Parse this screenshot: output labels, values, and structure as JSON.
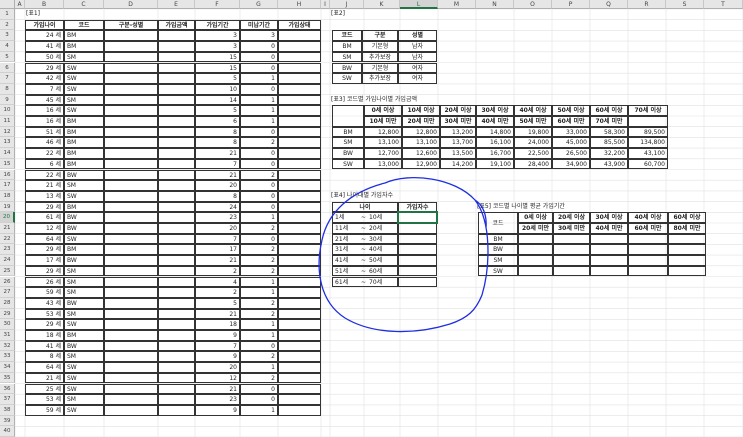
{
  "columns": [
    "A",
    "B",
    "C",
    "D",
    "E",
    "F",
    "G",
    "H",
    "I",
    "J",
    "K",
    "L",
    "M",
    "N",
    "O",
    "P",
    "Q",
    "R",
    "S",
    "T"
  ],
  "rows": [
    "1",
    "2",
    "3",
    "4",
    "5",
    "6",
    "7",
    "8",
    "9",
    "10",
    "11",
    "12",
    "13",
    "14",
    "15",
    "16",
    "17",
    "18",
    "19",
    "20",
    "21",
    "22",
    "23",
    "24",
    "25",
    "26",
    "27",
    "28",
    "29",
    "30",
    "31",
    "32",
    "33",
    "34",
    "35",
    "36",
    "37",
    "38",
    "39",
    "40"
  ],
  "selected_cell": {
    "col": "L",
    "row": "20"
  },
  "t1": {
    "title": "[표1]",
    "headers": [
      "가입나이",
      "코드",
      "구분-성별",
      "가입금액",
      "가입기간",
      "미납기간",
      "가입상태"
    ],
    "rows": [
      [
        "24 세",
        "BM",
        "3",
        "3"
      ],
      [
        "41 세",
        "BM",
        "3",
        "0"
      ],
      [
        "50 세",
        "SM",
        "15",
        "0"
      ],
      [
        "29 세",
        "SW",
        "15",
        "0"
      ],
      [
        "42 세",
        "SW",
        "5",
        "1"
      ],
      [
        "7 세",
        "SW",
        "10",
        "0"
      ],
      [
        "45 세",
        "SM",
        "14",
        "1"
      ],
      [
        "16 세",
        "SW",
        "5",
        "1"
      ],
      [
        "16 세",
        "BM",
        "6",
        "1"
      ],
      [
        "51 세",
        "BM",
        "8",
        "0"
      ],
      [
        "46 세",
        "BM",
        "8",
        "2"
      ],
      [
        "22 세",
        "BM",
        "21",
        "0"
      ],
      [
        "6 세",
        "BM",
        "7",
        "0"
      ],
      [
        "22 세",
        "BW",
        "21",
        "2"
      ],
      [
        "21 세",
        "SM",
        "20",
        "0"
      ],
      [
        "13 세",
        "SW",
        "8",
        "0"
      ],
      [
        "29 세",
        "BM",
        "24",
        "0"
      ],
      [
        "61 세",
        "BW",
        "23",
        "1"
      ],
      [
        "12 세",
        "BW",
        "20",
        "2"
      ],
      [
        "64 세",
        "SW",
        "7",
        "0"
      ],
      [
        "29 세",
        "BM",
        "17",
        "2"
      ],
      [
        "17 세",
        "BW",
        "21",
        "2"
      ],
      [
        "29 세",
        "SM",
        "2",
        "2"
      ],
      [
        "26 세",
        "SM",
        "4",
        "1"
      ],
      [
        "59 세",
        "SM",
        "2",
        "1"
      ],
      [
        "43 세",
        "BW",
        "5",
        "2"
      ],
      [
        "53 세",
        "SM",
        "21",
        "2"
      ],
      [
        "29 세",
        "SW",
        "18",
        "1"
      ],
      [
        "18 세",
        "BM",
        "9",
        "1"
      ],
      [
        "41 세",
        "BW",
        "7",
        "0"
      ],
      [
        "8 세",
        "SM",
        "9",
        "2"
      ],
      [
        "64 세",
        "SW",
        "20",
        "1"
      ],
      [
        "21 세",
        "SW",
        "12",
        "2"
      ],
      [
        "25 세",
        "SW",
        "21",
        "0"
      ],
      [
        "53 세",
        "SM",
        "23",
        "0"
      ],
      [
        "59 세",
        "SW",
        "9",
        "1"
      ]
    ]
  },
  "t2": {
    "title": "[표2]",
    "headers": [
      "코드",
      "구분",
      "성별"
    ],
    "rows": [
      [
        "BM",
        "기본형",
        "남자"
      ],
      [
        "SM",
        "추가보장",
        "남자"
      ],
      [
        "BW",
        "기본형",
        "여자"
      ],
      [
        "SW",
        "추가보장",
        "여자"
      ]
    ]
  },
  "t3": {
    "title": "[표3] 코드별 가입나이별 가입금액",
    "head1": [
      "0세 이상",
      "10세 이상",
      "20세 이상",
      "30세 이상",
      "40세 이상",
      "50세 이상",
      "60세 이상",
      "70세 이상"
    ],
    "head2": [
      "10세 미만",
      "20세 미만",
      "30세 미만",
      "40세 미만",
      "50세 미만",
      "60세 미만",
      "70세 미만",
      ""
    ],
    "rows": [
      [
        "BM",
        "12,800",
        "12,800",
        "13,200",
        "14,800",
        "19,800",
        "33,000",
        "58,300",
        "89,500"
      ],
      [
        "SM",
        "13,100",
        "13,100",
        "13,700",
        "16,100",
        "24,000",
        "45,000",
        "85,500",
        "134,800"
      ],
      [
        "BW",
        "12,700",
        "12,600",
        "13,500",
        "16,700",
        "22,500",
        "26,500",
        "32,200",
        "43,100"
      ],
      [
        "SW",
        "13,000",
        "12,900",
        "14,200",
        "19,100",
        "28,400",
        "34,900",
        "43,900",
        "60,700"
      ]
    ]
  },
  "t4": {
    "title": "[표4] 나이대별 가입자수",
    "headers": [
      "나이",
      "가입자수"
    ],
    "rows": [
      [
        "1세",
        "~",
        "10세"
      ],
      [
        "11세",
        "~",
        "20세"
      ],
      [
        "21세",
        "~",
        "30세"
      ],
      [
        "31세",
        "~",
        "40세"
      ],
      [
        "41세",
        "~",
        "50세"
      ],
      [
        "51세",
        "~",
        "60세"
      ],
      [
        "61세",
        "~",
        "70세"
      ]
    ]
  },
  "t5": {
    "title": "[표5] 코드별 나이별 평균 가입기간",
    "code_label": "코드",
    "head1": [
      "0세 이상",
      "20세 이상",
      "30세 이상",
      "40세 이상",
      "60세 이상"
    ],
    "head2": [
      "20세 미만",
      "30세 미만",
      "40세 미만",
      "60세 미만",
      "80세 미만"
    ],
    "rows": [
      "BM",
      "BW",
      "SM",
      "SW"
    ]
  },
  "annotation": {
    "shape": "hand-drawn-ellipse",
    "color": "#1f2ee0"
  }
}
